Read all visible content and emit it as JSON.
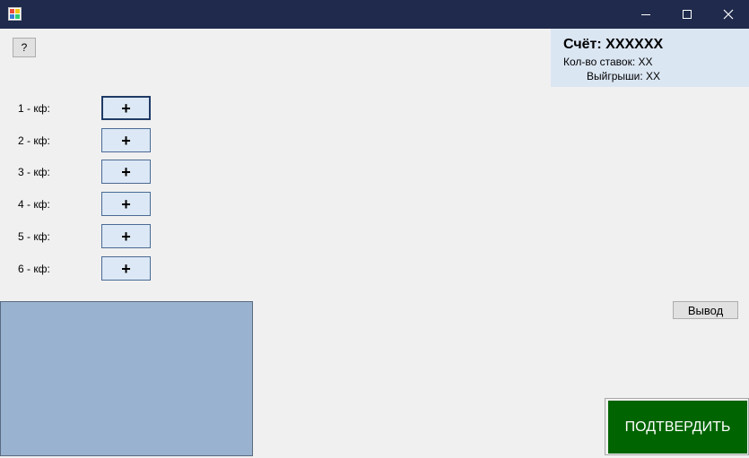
{
  "window": {
    "app_icon": "winforms-app-icon",
    "controls": {
      "minimize": "minimize-icon",
      "maximize": "maximize-icon",
      "close": "close-icon"
    }
  },
  "help_button": {
    "label": "?"
  },
  "score_panel": {
    "title": "Счёт: XXXXXX",
    "bets_count": "Кол-во ставок: XX",
    "wins": "Выйгрыши: XX"
  },
  "odds": [
    {
      "label": "1 - кф:",
      "button": "+"
    },
    {
      "label": "2 - кф:",
      "button": "+"
    },
    {
      "label": "3 - кф:",
      "button": "+"
    },
    {
      "label": "4 - кф:",
      "button": "+"
    },
    {
      "label": "5 - кф:",
      "button": "+"
    },
    {
      "label": "6 - кф:",
      "button": "+"
    }
  ],
  "output_button": {
    "label": "Вывод"
  },
  "confirm_button": {
    "label": "ПОДТВЕРДИТЬ"
  },
  "colors": {
    "titlebar": "#1f2a4c",
    "score_panel": "#dbe6f3",
    "output_panel": "#98b2d0",
    "confirm": "#006400"
  }
}
